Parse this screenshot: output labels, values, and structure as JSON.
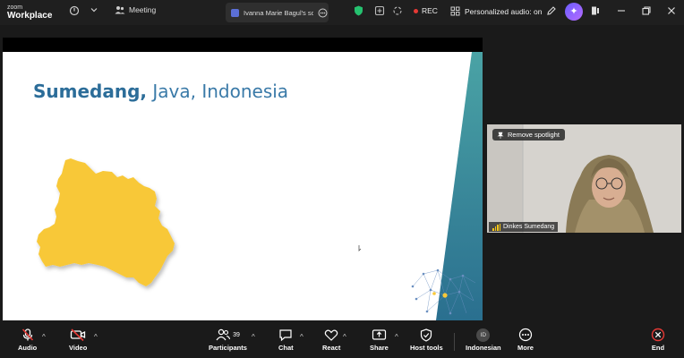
{
  "titlebar": {
    "brand_line1": "zoom",
    "brand_line2": "Workplace",
    "meeting_label": "Meeting",
    "share_tab_label": "Ivanna Marie Bagul's scr",
    "rec_label": "REC",
    "audio_label": "Personalized audio: on"
  },
  "slide": {
    "title_bold": "Sumedang,",
    "title_rest": " Java, Indonesia",
    "map_color": "#f8c838",
    "accent_color": "#2c6d99"
  },
  "video": {
    "spotlight_label": "Remove spotlight",
    "participant_name": "Dinkes Sumedang"
  },
  "toolbar": {
    "audio_label": "Audio",
    "video_label": "Video",
    "participants_label": "Participants",
    "participants_count": "39",
    "chat_label": "Chat",
    "react_label": "React",
    "share_label": "Share",
    "host_tools_label": "Host tools",
    "language_badge": "ID",
    "language_label": "Indonesian",
    "more_label": "More",
    "end_label": "End"
  }
}
